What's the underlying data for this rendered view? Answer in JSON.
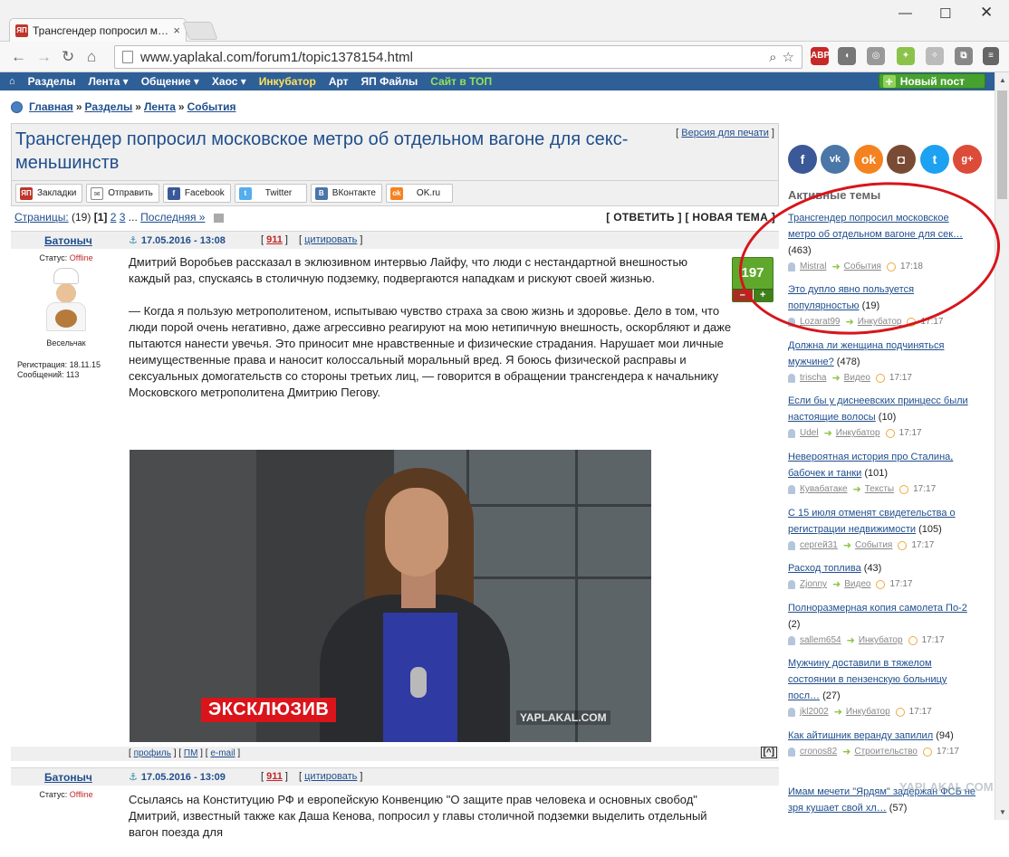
{
  "browser": {
    "tab_title": "Трансгендер попросил м…",
    "tab_favicon": "ЯП",
    "url": "www.yaplakal.com/forum1/topic1378154.html"
  },
  "nav": {
    "items": [
      "Разделы",
      "Лента ▾",
      "Общение ▾",
      "Хаос ▾",
      "Инкубатор",
      "Арт",
      "ЯП Файлы",
      "Сайт в ТОП"
    ],
    "new_post": "Новый пост"
  },
  "breadcrumb": [
    "Главная",
    "Разделы",
    "Лента",
    "События"
  ],
  "topic": {
    "title": "Трансгендер попросил московское метро об отдельном вагоне для секс-меньшинств",
    "print_version": "Версия для печати"
  },
  "share": [
    "Закладки",
    "Отправить",
    "Facebook",
    "Twitter",
    "ВКонтакте",
    "OK.ru"
  ],
  "pages": {
    "label": "Страницы:",
    "count": "(19)",
    "current": "[1]",
    "p2": "2",
    "p3": "3",
    "ellipsis": "...",
    "last": "Последняя »",
    "reply": "[ ОТВЕТИТЬ ]",
    "new_topic": "[ НОВАЯ ТЕМА ]"
  },
  "post1": {
    "nick": "Батоныч",
    "date": "17.05.2016 - 13:08",
    "num": "911",
    "cite": "цитировать",
    "status_label": "Статус:",
    "status": "Offline",
    "rank": "Весельчак",
    "reg": "Регистрация: 18.11.15",
    "msgs": "Сообщений: 113",
    "rating": "197",
    "p1": "Дмитрий Воробьев рассказал в эклюзивном интервью Лайфу, что люди с нестандартной внешностью каждый раз, спускаясь в столичную подземку, подвергаются нападкам и рискуют своей жизнью.",
    "p2": "— Когда я пользую метрополитеном, испытываю чувство страха за свою жизнь и здоровье. Дело в том, что люди порой очень негативно, даже агрессивно реагируют на мою нетипичную внешность, оскорбляют и даже пытаются нанести увечья. Это приносит мне нравственные и физические страдания. Нарушает мои личные неимущественные права и наносит колоссальный моральный вред. Я боюсь физической расправы и сексуальных домогательств со стороны третьих лиц, — говорится в обращении трансгендера к начальнику Московского метрополитена Дмитрию Пегову.",
    "video_badge": "ЭКСКЛЮЗИВ",
    "video_wm": "YAPLAKAL.COM",
    "foot_profile": "профиль",
    "foot_pm": "ПМ",
    "foot_email": "e-mail",
    "foot_up": "[^]"
  },
  "post2": {
    "nick": "Батоныч",
    "date": "17.05.2016 - 13:09",
    "num": "911",
    "cite": "цитировать",
    "status_label": "Статус:",
    "status": "Offline",
    "text": "Ссылаясь на Конституцию РФ и европейскую Конвенцию \"О защите прав человека и основных свобод\" Дмитрий, известный также как Даша Кенова, попросил у главы столичной подземки выделить отдельный вагон поезда для"
  },
  "sidebar": {
    "active_title": "Активные темы",
    "topics": [
      {
        "title": "Трансгендер попросил московское метро об отдельном вагоне для сек…",
        "count": "(463)",
        "user": "Mistral",
        "cat": "События",
        "time": "17:18"
      },
      {
        "title": "Это дупло явно пользуется популярностью",
        "count": "(19)",
        "user": "Lozarat99",
        "cat": "Инкубатор",
        "time": "17:17"
      },
      {
        "title": "Должна ли женщина подчиняться мужчине?",
        "count": "(478)",
        "user": "trischa",
        "cat": "Видео",
        "time": "17:17"
      },
      {
        "title": "Если бы у диснеевских принцесс были настоящие волосы",
        "count": "(10)",
        "user": "Udel",
        "cat": "Инкубатор",
        "time": "17:17"
      },
      {
        "title": "Невероятная история про Сталина, бабочек и танки",
        "count": "(101)",
        "user": "Кувабатаке",
        "cat": "Тексты",
        "time": "17:17"
      },
      {
        "title": "С 15 июля отменят свидетельства о регистрации недвижимости",
        "count": "(105)",
        "user": "сергей31",
        "cat": "События",
        "time": "17:17"
      },
      {
        "title": "Расход топлива",
        "count": "(43)",
        "user": "Zjonny",
        "cat": "Видео",
        "time": "17:17"
      },
      {
        "title": "Полноразмерная копия самолета По-2",
        "count": "(2)",
        "user": "sallem654",
        "cat": "Инкубатор",
        "time": "17:17"
      },
      {
        "title": "Мужчину доставили в тяжелом состоянии в пензенскую больницу посл…",
        "count": "(27)",
        "user": "jkl2002",
        "cat": "Инкубатор",
        "time": "17:17"
      },
      {
        "title": "Как айтишник веранду запилил",
        "count": "(94)",
        "user": "cronos82",
        "cat": "Строительство",
        "time": "17:17"
      },
      {
        "title": "Имам мечети \"Ярдям\" задержан ФСБ не зря кушает свой хл…",
        "count": "(57)",
        "user": "",
        "cat": "",
        "time": ""
      }
    ],
    "watermark": "YAPLAKAL.COM"
  },
  "colors": {
    "nav_bg": "#2f5f97",
    "link": "#1f4e8c",
    "accent_red": "#d8141b",
    "rating_green": "#5fa82c"
  }
}
